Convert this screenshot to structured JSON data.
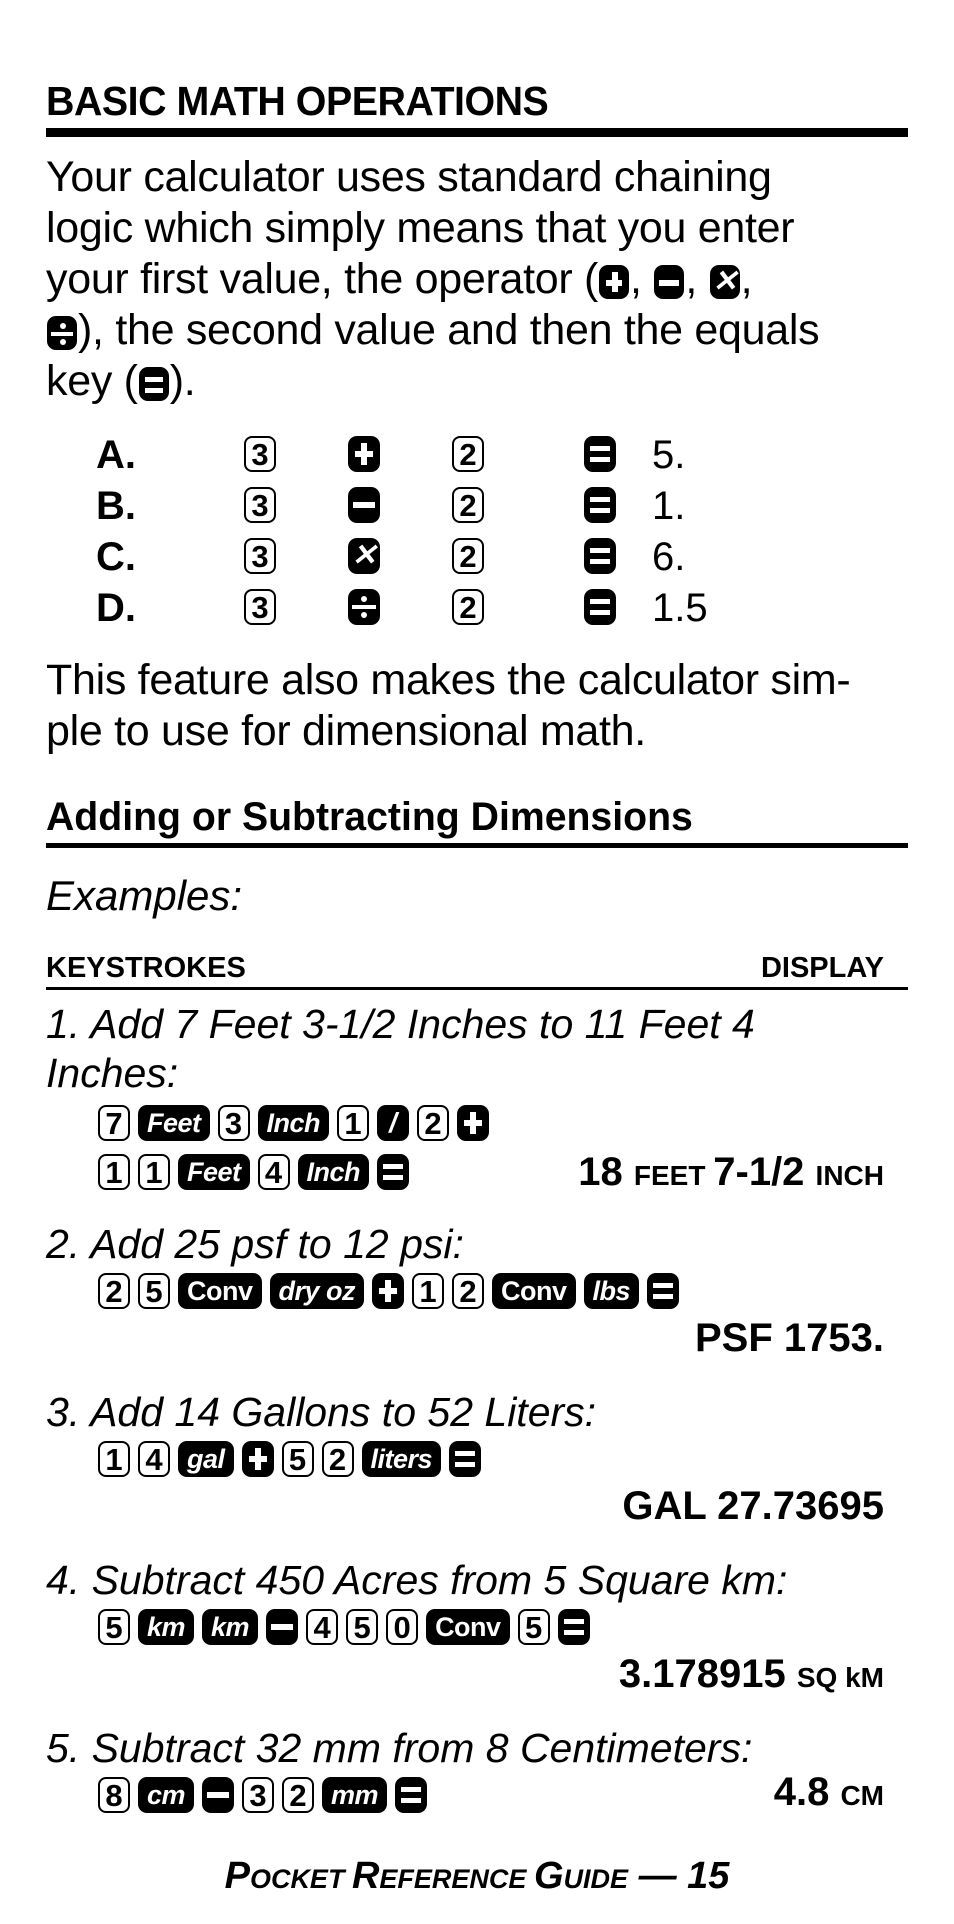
{
  "section_title": "BASIC MATH OPERATIONS",
  "intro": {
    "line1": "Your calculator uses standard chaining",
    "line2": "logic which simply means that you enter",
    "line3_a": "your first value, the operator (",
    "line3_sep": ",",
    "line4_b": "), the second value and then the equals",
    "line5_a": "key (",
    "line5_b": ")."
  },
  "operators": [
    "plus",
    "minus",
    "times",
    "divide",
    "equals"
  ],
  "basic_examples": [
    {
      "label": "A.",
      "a": "3",
      "op": "plus",
      "b": "2",
      "result": "5."
    },
    {
      "label": "B.",
      "a": "3",
      "op": "minus",
      "b": "2",
      "result": "1."
    },
    {
      "label": "C.",
      "a": "3",
      "op": "times",
      "b": "2",
      "result": "6."
    },
    {
      "label": "D.",
      "a": "3",
      "op": "divide",
      "b": "2",
      "result": "1.5"
    }
  ],
  "feature_note": {
    "line1": "This feature also makes the calculator sim-",
    "line2": "ple to use for dimensional math."
  },
  "subsection_title": "Adding or Subtracting Dimensions",
  "examples_label": "Examples:",
  "columns": {
    "keystrokes": "KEYSTROKES",
    "display": "DISPLAY"
  },
  "examples": [
    {
      "title_lines": [
        "1. Add 7 Feet 3-1/2 Inches to 11 Feet 4",
        "Inches:"
      ],
      "key_rows": [
        [
          {
            "t": "num",
            "v": "7"
          },
          {
            "t": "fn",
            "v": "Feet",
            "i": true
          },
          {
            "t": "num",
            "v": "3"
          },
          {
            "t": "fn",
            "v": "Inch",
            "i": true
          },
          {
            "t": "num",
            "v": "1"
          },
          {
            "t": "op",
            "v": "slash"
          },
          {
            "t": "num",
            "v": "2"
          },
          {
            "t": "op",
            "v": "plus"
          }
        ],
        [
          {
            "t": "num",
            "v": "1"
          },
          {
            "t": "num",
            "v": "1"
          },
          {
            "t": "fn",
            "v": "Feet",
            "i": true
          },
          {
            "t": "num",
            "v": "4"
          },
          {
            "t": "fn",
            "v": "Inch",
            "i": true
          },
          {
            "t": "op",
            "v": "equals"
          }
        ]
      ],
      "display": {
        "parts": [
          {
            "text": "18 ",
            "size": "big"
          },
          {
            "text": "FEET ",
            "size": "sm"
          },
          {
            "text": "7-1/2 ",
            "size": "big"
          },
          {
            "text": "INCH",
            "size": "sm"
          }
        ]
      }
    },
    {
      "title_lines": [
        "2. Add 25 psf to 12 psi:"
      ],
      "key_rows": [
        [
          {
            "t": "num",
            "v": "2"
          },
          {
            "t": "num",
            "v": "5"
          },
          {
            "t": "fn",
            "v": "Conv"
          },
          {
            "t": "fn",
            "v": "dry oz",
            "i": true
          },
          {
            "t": "op",
            "v": "plus"
          },
          {
            "t": "num",
            "v": "1"
          },
          {
            "t": "num",
            "v": "2"
          },
          {
            "t": "fn",
            "v": "Conv"
          },
          {
            "t": "fn",
            "v": "lbs",
            "i": true
          },
          {
            "t": "op",
            "v": "equals"
          }
        ]
      ],
      "display": {
        "parts": [
          {
            "text": "PSF 1753.",
            "size": "big"
          }
        ]
      }
    },
    {
      "title_lines": [
        "3. Add 14 Gallons to 52 Liters:"
      ],
      "key_rows": [
        [
          {
            "t": "num",
            "v": "1"
          },
          {
            "t": "num",
            "v": "4"
          },
          {
            "t": "fn",
            "v": "gal",
            "i": true
          },
          {
            "t": "op",
            "v": "plus"
          },
          {
            "t": "num",
            "v": "5"
          },
          {
            "t": "num",
            "v": "2"
          },
          {
            "t": "fn",
            "v": "liters",
            "i": true
          },
          {
            "t": "op",
            "v": "equals"
          }
        ]
      ],
      "display": {
        "parts": [
          {
            "text": "GAL 27.73695",
            "size": "big"
          }
        ]
      }
    },
    {
      "title_lines": [
        "4. Subtract 450 Acres from 5 Square km:"
      ],
      "key_rows": [
        [
          {
            "t": "num",
            "v": "5"
          },
          {
            "t": "fn",
            "v": "km",
            "i": true
          },
          {
            "t": "fn",
            "v": "km",
            "i": true
          },
          {
            "t": "op",
            "v": "minus"
          },
          {
            "t": "num",
            "v": "4"
          },
          {
            "t": "num",
            "v": "5"
          },
          {
            "t": "num",
            "v": "0"
          },
          {
            "t": "fn",
            "v": "Conv"
          },
          {
            "t": "num",
            "v": "5"
          },
          {
            "t": "op",
            "v": "equals"
          }
        ]
      ],
      "display": {
        "parts": [
          {
            "text": "3.178915 ",
            "size": "big"
          },
          {
            "text": "SQ kM",
            "size": "sm"
          }
        ]
      }
    },
    {
      "title_lines": [
        "5. Subtract 32 mm from 8 Centimeters:"
      ],
      "key_rows": [
        [
          {
            "t": "num",
            "v": "8"
          },
          {
            "t": "fn",
            "v": "cm",
            "i": true
          },
          {
            "t": "op",
            "v": "minus"
          },
          {
            "t": "num",
            "v": "3"
          },
          {
            "t": "num",
            "v": "2"
          },
          {
            "t": "fn",
            "v": "mm",
            "i": true
          },
          {
            "t": "op",
            "v": "equals"
          }
        ]
      ],
      "display": {
        "parts": [
          {
            "text": "4.8 ",
            "size": "big"
          },
          {
            "text": "CM",
            "size": "sm"
          }
        ]
      }
    }
  ],
  "footer": {
    "parts": [
      {
        "text": "P",
        "cls": "big"
      },
      {
        "text": "OCKET ",
        "cls": "sc"
      },
      {
        "text": "R",
        "cls": "big"
      },
      {
        "text": "EFERENCE ",
        "cls": "sc"
      },
      {
        "text": "G",
        "cls": "big"
      },
      {
        "text": "UIDE",
        "cls": "sc"
      },
      {
        "text": " — 15",
        "cls": "big"
      }
    ]
  }
}
